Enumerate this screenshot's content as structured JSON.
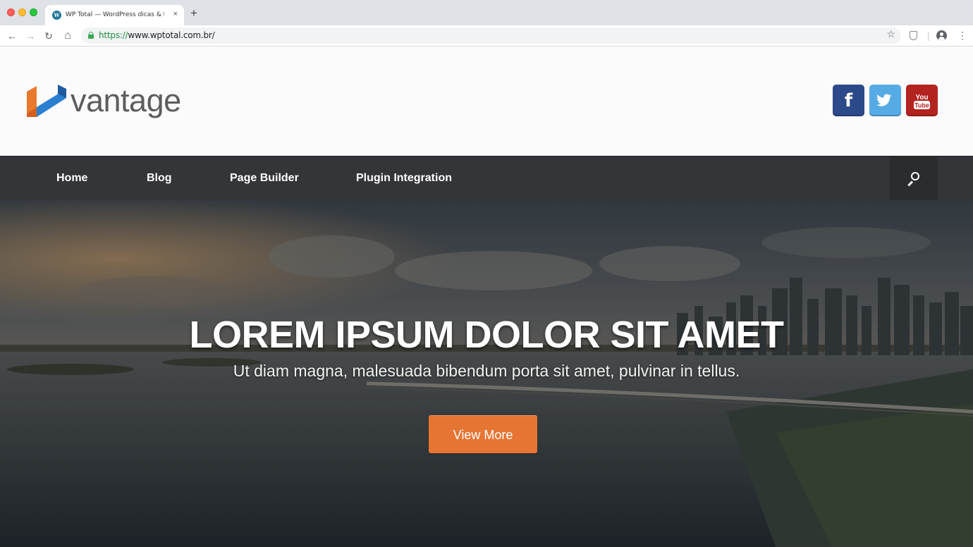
{
  "browser": {
    "tab_title": "WP Total — WordPress dicas & tutoriais.",
    "tab_close": "×",
    "new_tab": "+",
    "url_scheme": "https://",
    "url_rest": "www.wptotal.com.br/",
    "back": "←",
    "forward": "→",
    "reload": "↻",
    "home": "⌂",
    "star": "☆",
    "menu": "⋮"
  },
  "site": {
    "logo_text": "vantage",
    "logo_colors": {
      "orange": "#e8792f",
      "blue": "#2a7fd0",
      "dark_blue": "#1e5a9e"
    },
    "social": [
      {
        "name": "facebook",
        "glyph": "f",
        "color": "#2c4a8a"
      },
      {
        "name": "twitter",
        "color": "#56abe4"
      },
      {
        "name": "youtube",
        "color": "#b3231f",
        "text_top": "You",
        "text_bottom": "Tube"
      }
    ]
  },
  "nav": {
    "items": [
      {
        "label": "Home"
      },
      {
        "label": "Blog"
      },
      {
        "label": "Page Builder"
      },
      {
        "label": "Plugin Integration"
      }
    ],
    "background": "#343538"
  },
  "hero": {
    "title": "LOREM IPSUM DOLOR SIT AMET",
    "subtitle": "Ut diam magna, malesuada bibendum porta sit amet, pulvinar in tellus.",
    "button_label": "View More",
    "button_color": "#e67534"
  }
}
